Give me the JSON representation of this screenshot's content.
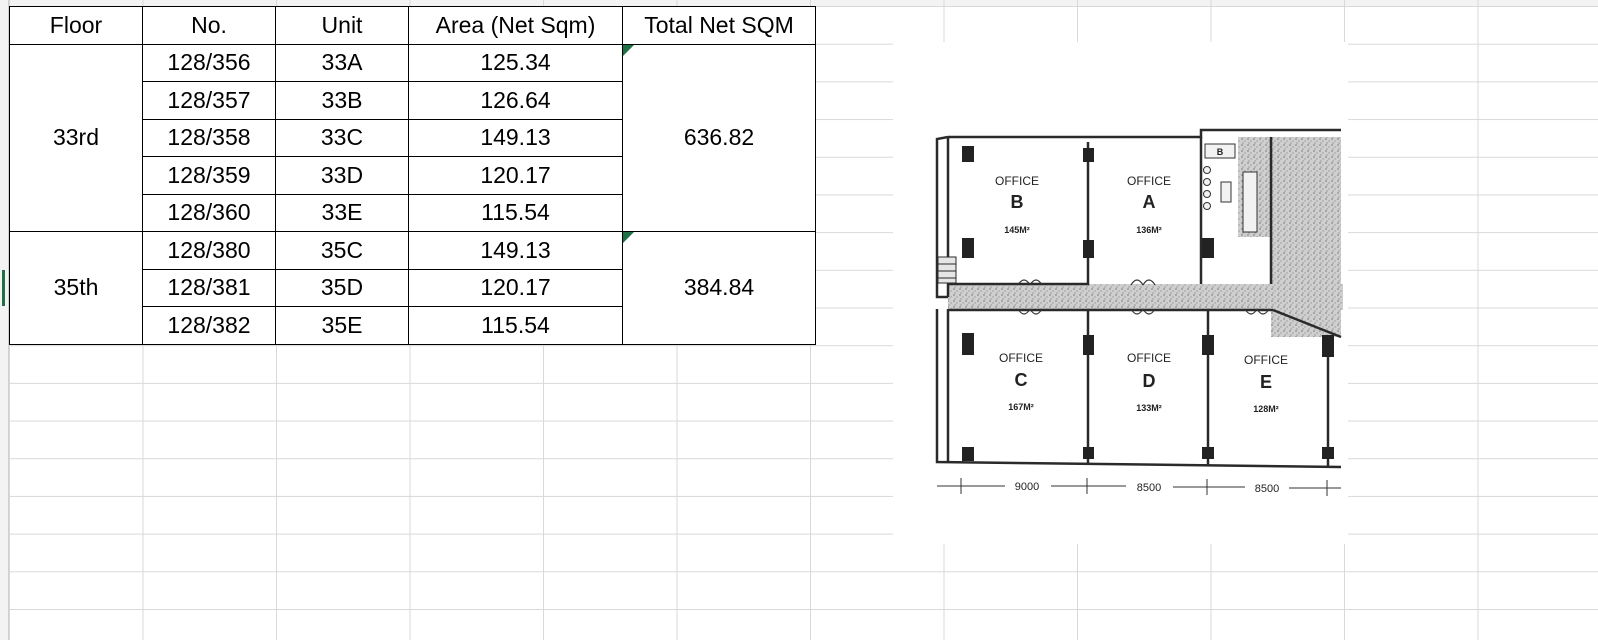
{
  "table": {
    "headers": [
      "Floor",
      "No.",
      "Unit",
      "Area (Net Sqm)",
      "Total Net SQM"
    ],
    "groups": [
      {
        "floor": "33rd",
        "total": "636.82",
        "rows": [
          {
            "no": "128/356",
            "unit": "33A",
            "area": "125.34"
          },
          {
            "no": "128/357",
            "unit": "33B",
            "area": "126.64"
          },
          {
            "no": "128/358",
            "unit": "33C",
            "area": "149.13"
          },
          {
            "no": "128/359",
            "unit": "33D",
            "area": "120.17"
          },
          {
            "no": "128/360",
            "unit": "33E",
            "area": "115.54"
          }
        ]
      },
      {
        "floor": "35th",
        "total": "384.84",
        "rows": [
          {
            "no": "128/380",
            "unit": "35C",
            "area": "149.13"
          },
          {
            "no": "128/381",
            "unit": "35D",
            "area": "120.17"
          },
          {
            "no": "128/382",
            "unit": "35E",
            "area": "115.54"
          }
        ]
      }
    ]
  },
  "floor_plan": {
    "offices": [
      {
        "word": "OFFICE",
        "letter": "B",
        "area": "145M²"
      },
      {
        "word": "OFFICE",
        "letter": "A",
        "area": "136M²"
      },
      {
        "word": "OFFICE",
        "letter": "C",
        "area": "167M²"
      },
      {
        "word": "OFFICE",
        "letter": "D",
        "area": "133M²"
      },
      {
        "word": "OFFICE",
        "letter": "E",
        "area": "128M²"
      }
    ],
    "stair_label": "B",
    "dimensions": [
      "9000",
      "8500",
      "8500"
    ]
  },
  "colors": {
    "comment_marker": "#1e7145",
    "gridline": "#d9d9d9",
    "plan_ink": "#2a2a2a"
  }
}
